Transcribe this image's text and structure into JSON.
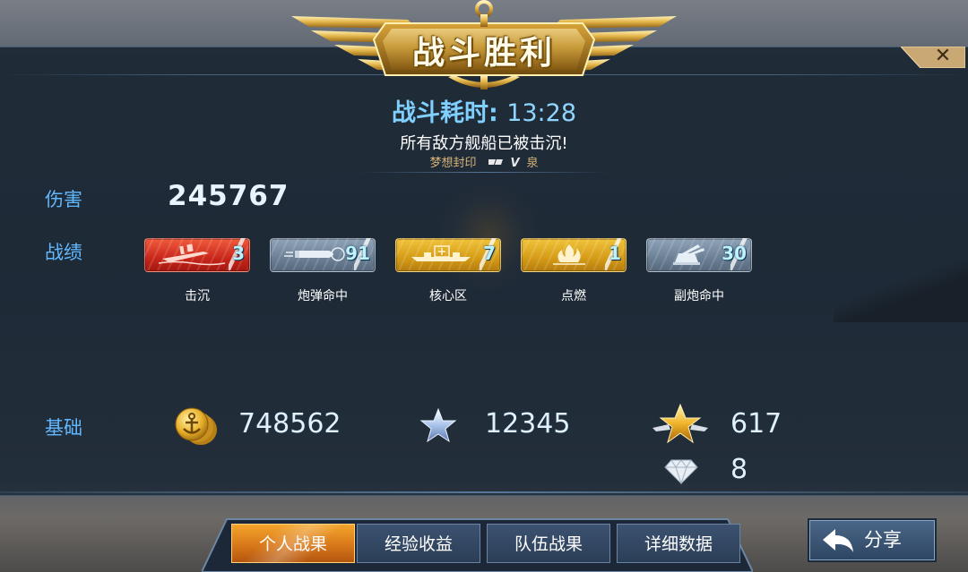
{
  "banner": {
    "title": "战斗胜利"
  },
  "close": {
    "glyph": "✕"
  },
  "header": {
    "battle_time_label": "战斗耗时:",
    "battle_time_value": "13:28",
    "result_message": "所有敌方舰船已被击沉!",
    "player_name_part1": "梦想封印",
    "player_name_part2": "V",
    "player_name_part3": "泉"
  },
  "damage": {
    "label": "伤害",
    "value": "245767"
  },
  "record": {
    "label": "战绩",
    "badges": [
      {
        "label": "击沉",
        "count": "3",
        "icon": "sinking-ship-icon",
        "color": "red"
      },
      {
        "label": "炮弹命中",
        "count": "91",
        "icon": "shell-hit-icon",
        "color": "grey"
      },
      {
        "label": "核心区",
        "count": "7",
        "icon": "core-zone-icon",
        "color": "gold"
      },
      {
        "label": "点燃",
        "count": "1",
        "icon": "fire-icon",
        "color": "gold"
      },
      {
        "label": "副炮命中",
        "count": "30",
        "icon": "secondary-gun-icon",
        "color": "grey"
      }
    ]
  },
  "base": {
    "label": "基础",
    "gold": {
      "value": "748562",
      "icon": "anchor-coin-icon"
    },
    "exp": {
      "value": "12345",
      "icon": "blue-star-icon"
    },
    "rank": {
      "value": "617",
      "icon": "gold-winged-star-icon"
    },
    "diamond": {
      "value": "8",
      "icon": "diamond-icon"
    }
  },
  "tabs": [
    {
      "label": "个人战果",
      "active": true
    },
    {
      "label": "经验收益",
      "active": false
    },
    {
      "label": "队伍战果",
      "active": false
    },
    {
      "label": "详细数据",
      "active": false
    }
  ],
  "share": {
    "label": "分享",
    "icon": "share-arrow-icon"
  },
  "colors": {
    "accent_blue": "#62b8ff",
    "time_blue": "#7fd0ff",
    "gold": "#e3b23c",
    "active_tab": "#e38a1f",
    "panel": "#1f2b38"
  }
}
